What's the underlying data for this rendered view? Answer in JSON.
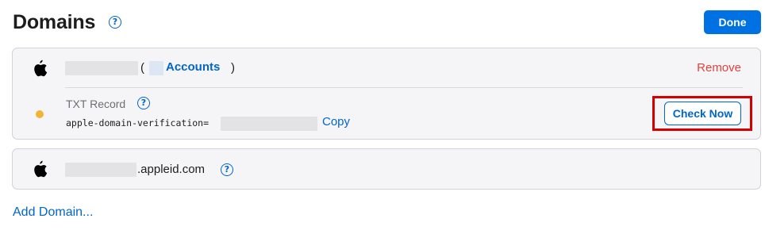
{
  "header": {
    "title": "Domains",
    "help_icon": "question-circle-icon",
    "done_label": "Done"
  },
  "domains": [
    {
      "icon": "apple-logo-icon",
      "name_redacted": true,
      "paren_open": "(",
      "accounts_label": "Accounts",
      "paren_close": ")",
      "remove_label": "Remove",
      "txt": {
        "label": "TXT Record",
        "value_prefix": "apple-domain-verification=",
        "copy_label": "Copy",
        "check_label": "Check Now",
        "status_color": "#f5b335"
      }
    },
    {
      "icon": "apple-logo-icon",
      "name_redacted": true,
      "suffix": ".appleid.com"
    }
  ],
  "add_domain_label": "Add Domain...",
  "colors": {
    "accent": "#0071e3",
    "link": "#0066cc",
    "danger": "#e0443e",
    "highlight": "#d40000",
    "pending": "#f5b335"
  }
}
